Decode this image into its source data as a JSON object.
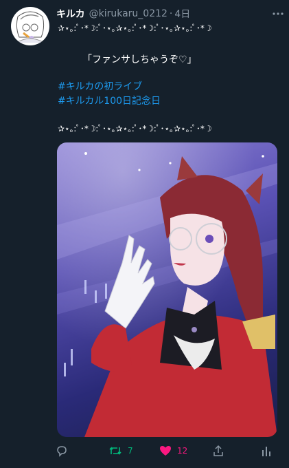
{
  "tweet": {
    "display_name": "キルカ",
    "handle": "@kirukaru_0212",
    "separator": "·",
    "time": "4日",
    "decor_line_1": "✰⋆｡:ﾟ･*☽:ﾟ･⋆｡✰⋆｡:ﾟ･*☽:ﾟ･⋆｡✰⋆｡:ﾟ･*☽",
    "quote": "「ファンサしちゃうぞ♡」",
    "hashtags": [
      "#キルカの初ライブ",
      "#キルカル100日記念日"
    ],
    "decor_line_2": "✰⋆｡:ﾟ･*☽:ﾟ･⋆｡✰⋆｡:ﾟ･*☽:ﾟ･⋆｡✰⋆｡:ﾟ･*☽"
  },
  "actions": {
    "reply_icon": "reply-icon",
    "retweet_icon": "retweet-icon",
    "retweet_count": "7",
    "like_icon": "heart-icon",
    "like_count": "12",
    "share_icon": "share-icon",
    "analytics_icon": "analytics-icon"
  },
  "colors": {
    "background": "#15202b",
    "text": "#ffffff",
    "muted": "#8b98a5",
    "link": "#1d9bf0",
    "retweet": "#00ba7c",
    "like": "#f91880"
  }
}
